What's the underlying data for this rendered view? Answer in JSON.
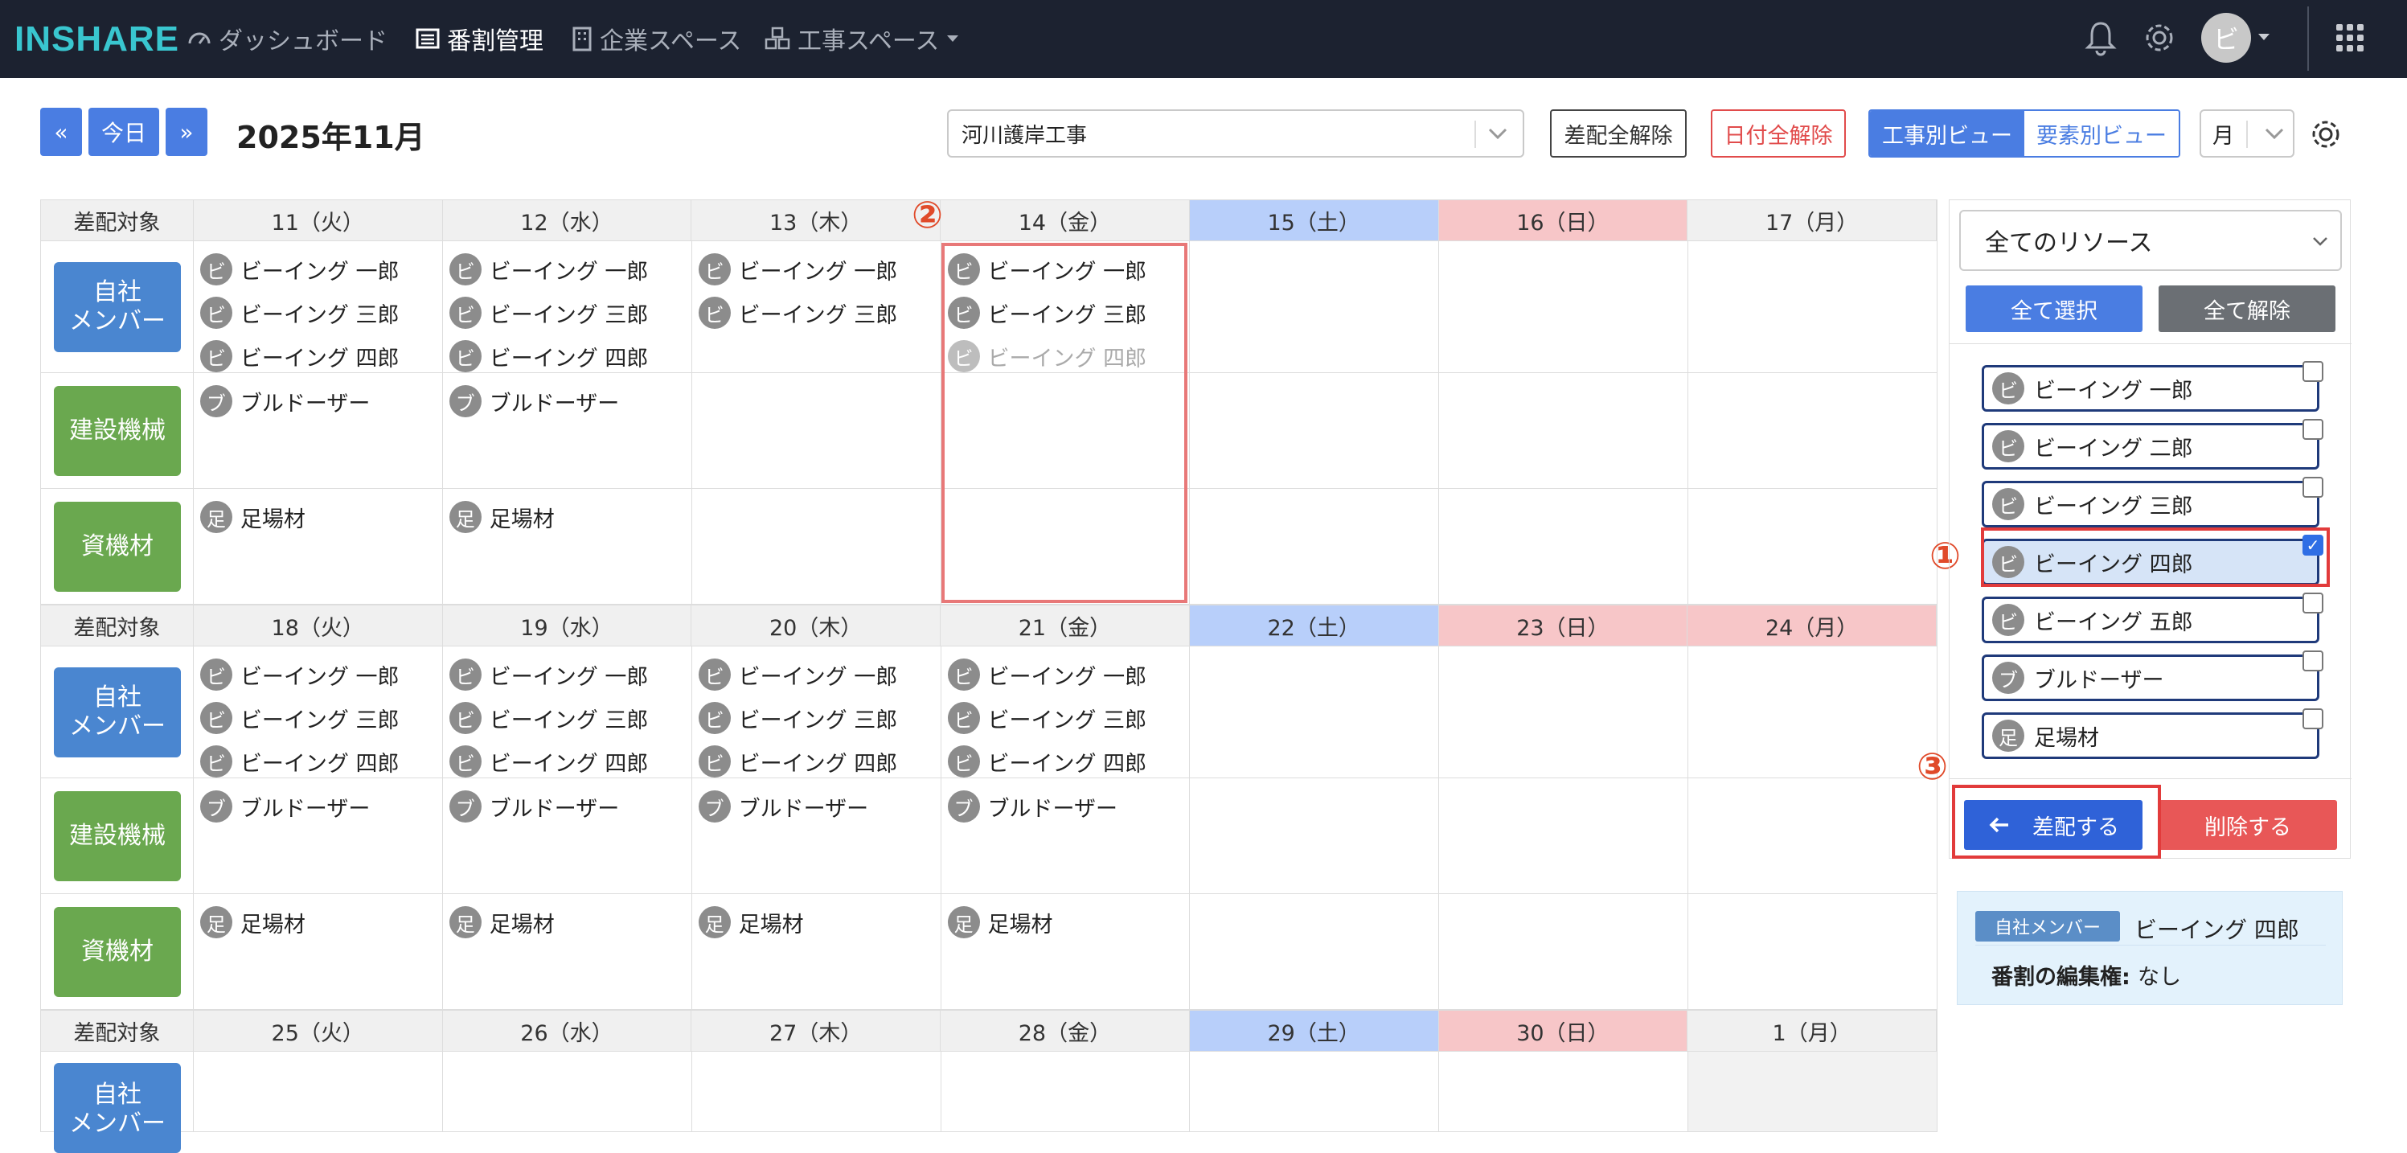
{
  "nav": {
    "logo": "INSHARE",
    "items": [
      {
        "label": "ダッシュボード"
      },
      {
        "label": "番割管理"
      },
      {
        "label": "企業スペース"
      },
      {
        "label": "工事スペース"
      }
    ],
    "avatar": "ビ"
  },
  "toolbar": {
    "prev": "«",
    "today": "今日",
    "next": "»",
    "month": "2025年11月",
    "project": "河川護岸工事",
    "clear_assign": "差配全解除",
    "clear_dates": "日付全解除",
    "view_by_project": "工事別ビュー",
    "view_by_element": "要素別ビュー",
    "period": "月"
  },
  "calendar": {
    "row_header_label": "差配対象",
    "categories": {
      "member": "自社\nメンバー",
      "machine": "建設機械",
      "material": "資機材"
    },
    "weeks": [
      {
        "days": [
          "11（火）",
          "12（水）",
          "13（木）",
          "14（金）",
          "15（土）",
          "16（日）",
          "17（月）"
        ],
        "members": [
          [
            "ビーイング 一郎",
            "ビーイング 三郎",
            "ビーイング 四郎"
          ],
          [
            "ビーイング 一郎",
            "ビーイング 三郎",
            "ビーイング 四郎"
          ],
          [
            "ビーイング 一郎",
            "ビーイング 三郎"
          ],
          [
            "ビーイング 一郎",
            "ビーイング 三郎",
            "ビーイング 四郎"
          ],
          [],
          [],
          []
        ],
        "machines": [
          [
            "ブルドーザー"
          ],
          [
            "ブルドーザー"
          ],
          [],
          [],
          [],
          [],
          []
        ],
        "materials": [
          [
            "足場材"
          ],
          [
            "足場材"
          ],
          [],
          [],
          [],
          [],
          []
        ]
      },
      {
        "days": [
          "18（火）",
          "19（水）",
          "20（木）",
          "21（金）",
          "22（土）",
          "23（日）",
          "24（月）"
        ],
        "members": [
          [
            "ビーイング 一郎",
            "ビーイング 三郎",
            "ビーイング 四郎"
          ],
          [
            "ビーイング 一郎",
            "ビーイング 三郎",
            "ビーイング 四郎"
          ],
          [
            "ビーイング 一郎",
            "ビーイング 三郎",
            "ビーイング 四郎"
          ],
          [
            "ビーイング 一郎",
            "ビーイング 三郎",
            "ビーイング 四郎"
          ],
          [],
          [],
          []
        ],
        "machines": [
          [
            "ブルドーザー"
          ],
          [
            "ブルドーザー"
          ],
          [
            "ブルドーザー"
          ],
          [
            "ブルドーザー"
          ],
          [],
          [],
          []
        ],
        "materials": [
          [
            "足場材"
          ],
          [
            "足場材"
          ],
          [
            "足場材"
          ],
          [
            "足場材"
          ],
          [],
          [],
          []
        ]
      },
      {
        "days": [
          "25（火）",
          "26（水）",
          "27（木）",
          "28（金）",
          "29（土）",
          "30（日）",
          "1（月）"
        ]
      }
    ]
  },
  "panel": {
    "resource_filter": "全てのリソース",
    "select_all": "全て選択",
    "deselect_all": "全て解除",
    "resources": [
      {
        "badge": "ビ",
        "label": "ビーイング 一郎",
        "checked": false
      },
      {
        "badge": "ビ",
        "label": "ビーイング 二郎",
        "checked": false
      },
      {
        "badge": "ビ",
        "label": "ビーイング 三郎",
        "checked": false
      },
      {
        "badge": "ビ",
        "label": "ビーイング 四郎",
        "checked": true
      },
      {
        "badge": "ビ",
        "label": "ビーイング 五郎",
        "checked": false
      },
      {
        "badge": "ブ",
        "label": "ブルドーザー",
        "checked": false
      },
      {
        "badge": "足",
        "label": "足場材",
        "checked": false
      }
    ],
    "assign": "差配する",
    "delete": "削除する",
    "info": {
      "badge": "自社メンバー",
      "name": "ビーイング 四郎",
      "perm_label": "番割の編集権:",
      "perm_value": "なし"
    }
  },
  "callouts": [
    "①",
    "②",
    "③"
  ],
  "colors": {
    "accent": "#4a7de2",
    "danger": "#e85757",
    "member": "#4a86d0",
    "machine": "#6aa84f",
    "saturday": "#b8cffa",
    "sunday": "#f7c6c8"
  }
}
